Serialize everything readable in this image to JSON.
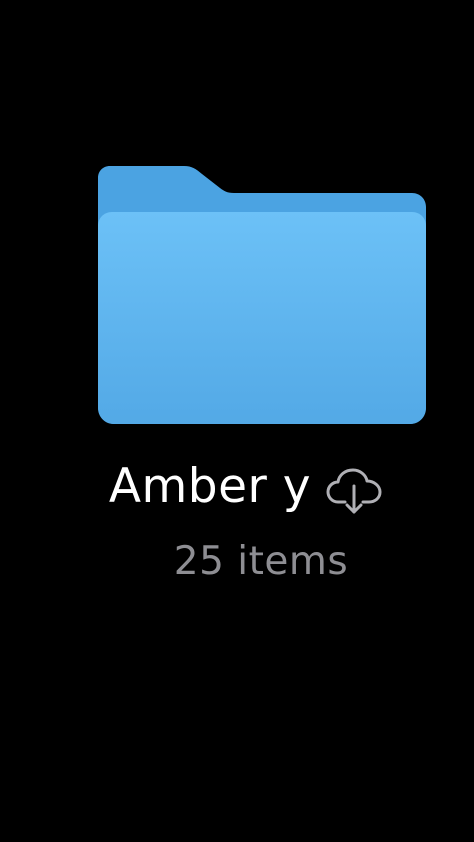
{
  "folder": {
    "name": "Amber y",
    "item_count": "25 items",
    "icon": "folder-icon",
    "status_icon": "cloud-download-icon",
    "colors": {
      "background": "#000000",
      "folder_back": "#4ba3e2",
      "folder_front_top": "#6cc1f7",
      "folder_front_bottom": "#53a9e6",
      "name_text": "#ffffff",
      "count_text": "#8e8e93",
      "cloud_stroke": "#b0b0b5"
    }
  }
}
